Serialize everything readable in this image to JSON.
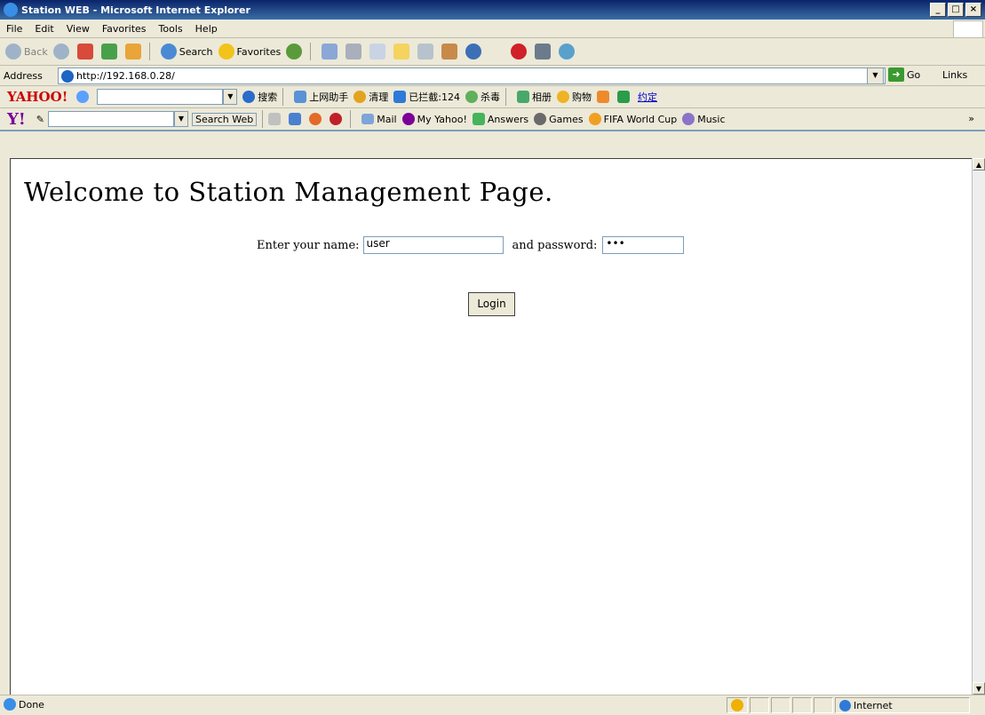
{
  "window": {
    "title": "Station WEB - Microsoft Internet Explorer",
    "controls": [
      "_",
      "□",
      "×"
    ]
  },
  "menu": [
    "File",
    "Edit",
    "View",
    "Favorites",
    "Tools",
    "Help"
  ],
  "toolbar": {
    "back": "Back",
    "search": "Search",
    "favorites": "Favorites"
  },
  "address": {
    "label": "Address",
    "url": "http://192.168.0.28/",
    "go": "Go",
    "links": "Links"
  },
  "yahoo_cn": {
    "logo": "YAHOO!",
    "items": [
      "搜索",
      "上网助手",
      "清理",
      "已拦截:124",
      "杀毒",
      "相册",
      "购物",
      "约定"
    ]
  },
  "yahoo_toolbar": {
    "logo": "Y!",
    "search": "Search Web",
    "items": [
      "Mail",
      "My Yahoo!",
      "Answers",
      "Games",
      "FIFA World Cup",
      "Music"
    ],
    "more": "»"
  },
  "page": {
    "heading": "Welcome to Station Management Page.",
    "name_label": "Enter your name:",
    "name_value": "user",
    "password_label": "and password:",
    "password_mask": "•••",
    "login": "Login"
  },
  "status": {
    "text": "Done",
    "zone": "Internet"
  }
}
